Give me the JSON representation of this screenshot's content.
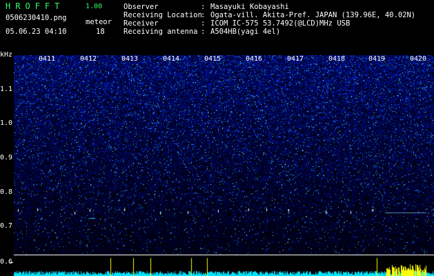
{
  "header": {
    "app_title": "HROFFT",
    "version": "1.00",
    "file_name": "0506230410.png",
    "date_time": "05.06.23 04:10",
    "meteor_label": "meteor",
    "meteor_count": "18"
  },
  "info": [
    {
      "label": "Observer",
      "value": "Masayuki Kobayashi"
    },
    {
      "label": "Receiving Location",
      "value": "Ogata-vill. Akita-Pref. JAPAN (139.96E, 40.02N)"
    },
    {
      "label": "Receiver",
      "value": "ICOM IC-575 53.7492(@LCD)MHz USB"
    },
    {
      "label": "Receiving antenna",
      "value": "A504HB(yagi 4el)"
    }
  ],
  "spectrogram": {
    "y_unit": "kHz",
    "y_ticks": [
      "1.1",
      "1.0",
      "0.9",
      "0.8",
      "0.7",
      "0.6"
    ],
    "x_ticks": [
      "0411",
      "0412",
      "0413",
      "0414",
      "0415",
      "0416",
      "0417",
      "0418",
      "0419",
      "0420"
    ],
    "colors": {
      "background": "#000000",
      "text": "#ffffff",
      "title": "#33ff66",
      "signal": "#00ffff",
      "meteor": "#ffff00"
    }
  }
}
